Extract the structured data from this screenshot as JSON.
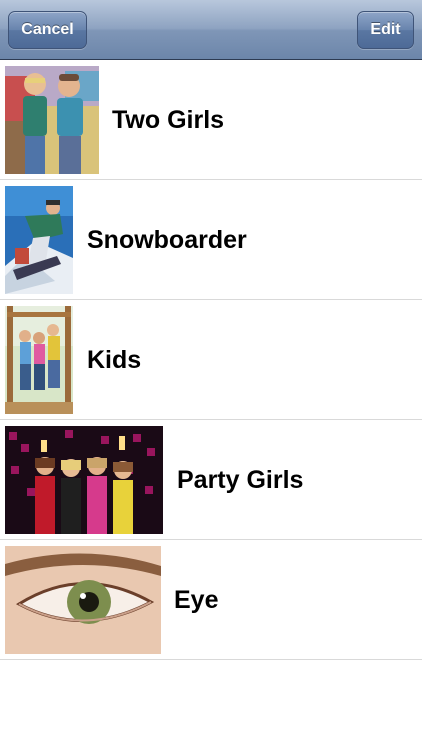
{
  "navbar": {
    "cancel_label": "Cancel",
    "edit_label": "Edit"
  },
  "items": [
    {
      "label": "Two Girls",
      "image": "photo-two-girls"
    },
    {
      "label": "Snowboarder",
      "image": "photo-snowboarder"
    },
    {
      "label": "Kids",
      "image": "photo-kids"
    },
    {
      "label": "Party Girls",
      "image": "photo-party-girls"
    },
    {
      "label": "Eye",
      "image": "photo-eye"
    }
  ]
}
